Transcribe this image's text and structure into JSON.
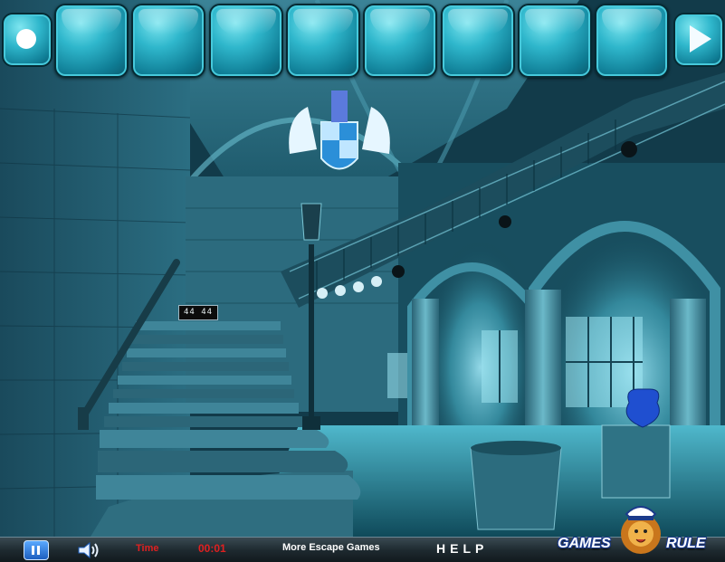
{
  "inventory": {
    "slot_count": 8
  },
  "keypad": {
    "display": "44 44"
  },
  "bottom_bar": {
    "time_label": "Time",
    "time_value": "00:01",
    "more_games": "More Escape Games",
    "help": "HELP"
  },
  "logo": {
    "left": "GAMES",
    "right": "RULE"
  },
  "icons": {
    "menu": "menu-dot-icon",
    "next": "next-arrow-icon",
    "pause": "pause-icon",
    "sound": "speaker-icon"
  },
  "colors": {
    "slot": "#2fb7cc",
    "timer_text": "#e02020",
    "bar_text": "#ffffff",
    "logo_outline": "#1b3a8a"
  }
}
